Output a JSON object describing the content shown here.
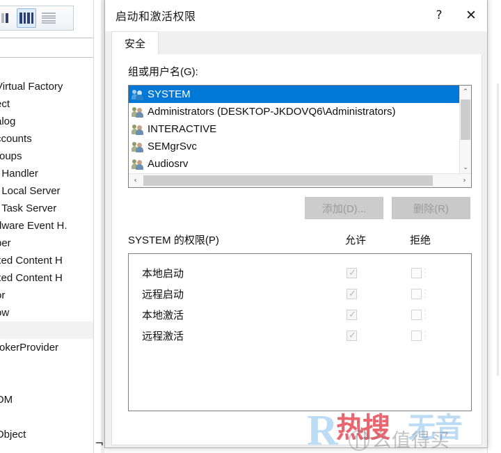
{
  "background": {
    "toolbar": {
      "icons": [
        {
          "name": "large-icons-view-icon",
          "selected": false
        },
        {
          "name": "list-view-icon",
          "selected": true
        },
        {
          "name": "detail-view-icon",
          "selected": false
        }
      ]
    },
    "list_items": [
      "Virtual Factory",
      "ect",
      "alog",
      "ccounts",
      "roups",
      "t Handler",
      "t Local Server",
      "t Task Server",
      "dware Event H.",
      "per",
      "xed Content H",
      "xed Content H",
      "or",
      "ow",
      "",
      "rokerProvider",
      "",
      "",
      "OM",
      "",
      "Object"
    ],
    "highlighted_index": 14
  },
  "dialog": {
    "title": "启动和激活权限",
    "help_button": "?",
    "close_button": "✕",
    "tab": {
      "label": "安全"
    },
    "group_section": {
      "label": "组或用户名(G):",
      "entries": [
        {
          "name": "SYSTEM",
          "selected": true
        },
        {
          "name": "Administrators (DESKTOP-JKDOVQ6\\Administrators)",
          "selected": false
        },
        {
          "name": "INTERACTIVE",
          "selected": false
        },
        {
          "name": "SEMgrSvc",
          "selected": false
        },
        {
          "name": "Audiosrv",
          "selected": false
        }
      ],
      "scroll": {
        "up_arrow": "⌃",
        "down_arrow": "⌄",
        "left_arrow": "‹",
        "right_arrow": "›"
      }
    },
    "buttons": {
      "add": "添加(D)...",
      "remove": "删除(R)"
    },
    "permissions": {
      "title": "SYSTEM 的权限(P)",
      "columns": {
        "allow": "允许",
        "deny": "拒绝"
      },
      "rows": [
        {
          "name": "本地启动",
          "allow": true,
          "deny": false
        },
        {
          "name": "远程启动",
          "allow": true,
          "deny": false
        },
        {
          "name": "本地激活",
          "allow": true,
          "deny": false
        },
        {
          "name": "远程激活",
          "allow": true,
          "deny": false
        }
      ],
      "check_glyph": "✓"
    }
  },
  "watermark": {
    "letter": "R",
    "red_text": "热搜",
    "blue_text": "无音",
    "grey_text": "什么值得买"
  },
  "colors": {
    "selection_blue": "#0078d7",
    "watermark_red": "#e8505a",
    "watermark_blue": "#bcdcf5",
    "dialog_chrome": "#f0f0f0"
  }
}
